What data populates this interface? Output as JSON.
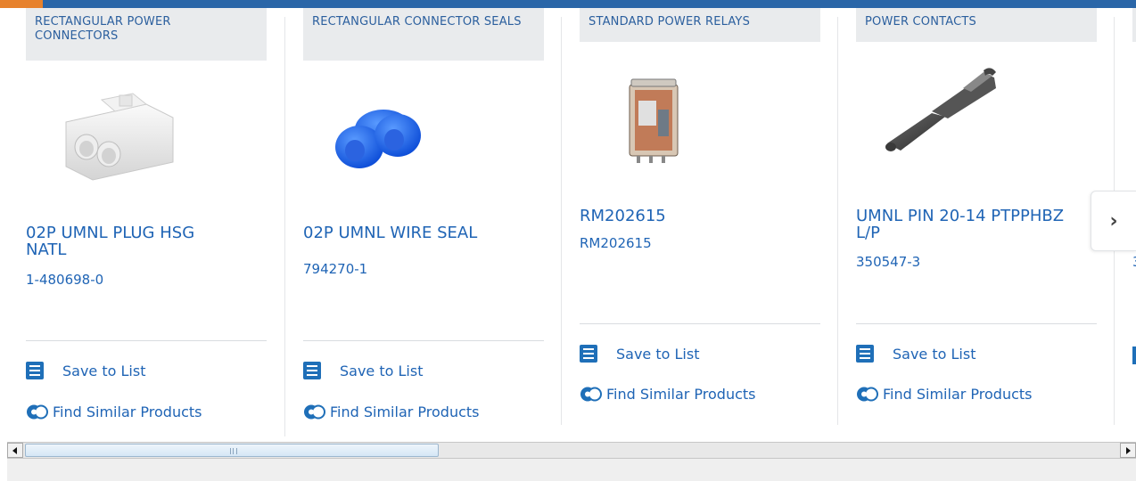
{
  "colors": {
    "link": "#1f64b5",
    "category_bg": "#e9ebed",
    "accent_orange": "#e7822d",
    "accent_blue": "#2a66a8"
  },
  "products": [
    {
      "category": "RECTANGULAR POWER CONNECTORS",
      "name": "02P UMNL PLUG HSG NATL",
      "part": "1-480698-0",
      "save_label": "Save to List",
      "similar_label": "Find Similar Products"
    },
    {
      "category": "RECTANGULAR CONNECTOR SEALS",
      "name": "02P UMNL WIRE SEAL",
      "part": "794270-1",
      "save_label": "Save to List",
      "similar_label": "Find Similar Products"
    },
    {
      "category": "STANDARD POWER RELAYS",
      "name": "RM202615",
      "part": "RM202615",
      "save_label": "Save to List",
      "similar_label": "Find Similar Products"
    },
    {
      "category": "POWER CONTACTS",
      "name": "UMNL PIN 20-14 PTPPHBZ L/P",
      "part": "350547-3",
      "save_label": "Save to List",
      "similar_label": "Find Similar Products"
    }
  ],
  "partial_card": {
    "part_fragment": "3"
  },
  "nav": {
    "next_icon": "chevron-right-icon",
    "next_glyph": "›"
  }
}
